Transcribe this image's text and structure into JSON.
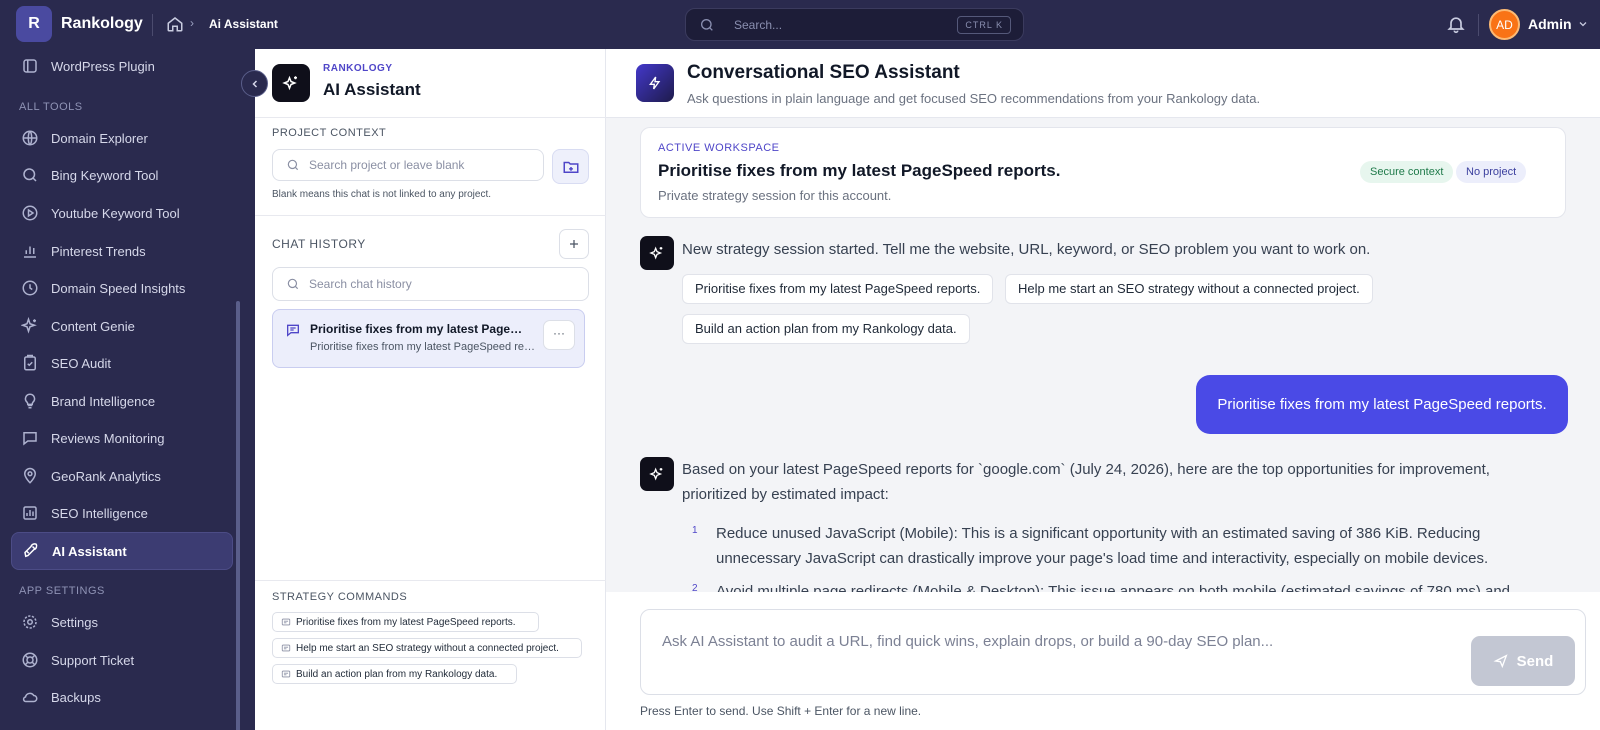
{
  "app": {
    "logo_letter": "R",
    "name": "Rankology"
  },
  "breadcrumb": {
    "current": "Ai Assistant"
  },
  "search": {
    "placeholder": "Search...",
    "shortcut": "CTRL K"
  },
  "user": {
    "initials": "AD",
    "name": "Admin"
  },
  "sidebar": {
    "top_items": [
      {
        "label": "WordPress Plugin",
        "icon": "plug-icon"
      }
    ],
    "sections": [
      {
        "title": "ALL TOOLS",
        "items": [
          {
            "label": "Domain Explorer",
            "icon": "globe-icon"
          },
          {
            "label": "Bing Keyword Tool",
            "icon": "search-icon"
          },
          {
            "label": "Youtube Keyword Tool",
            "icon": "play-circle-icon"
          },
          {
            "label": "Pinterest Trends",
            "icon": "bar-chart-icon"
          },
          {
            "label": "Domain Speed Insights",
            "icon": "clock-icon"
          },
          {
            "label": "Content Genie",
            "icon": "sparkles-icon"
          },
          {
            "label": "SEO Audit",
            "icon": "clipboard-check-icon"
          },
          {
            "label": "Brand Intelligence",
            "icon": "lightbulb-icon"
          },
          {
            "label": "Reviews Monitoring",
            "icon": "message-square-icon"
          },
          {
            "label": "GeoRank Analytics",
            "icon": "map-pin-icon"
          },
          {
            "label": "SEO Intelligence",
            "icon": "line-chart-icon"
          },
          {
            "label": "AI Assistant",
            "icon": "rocket-icon",
            "active": true
          }
        ]
      },
      {
        "title": "APP SETTINGS",
        "items": [
          {
            "label": "Settings",
            "icon": "gear-icon"
          },
          {
            "label": "Support Ticket",
            "icon": "lifebuoy-icon"
          },
          {
            "label": "Backups",
            "icon": "cloud-icon"
          }
        ]
      }
    ]
  },
  "panel": {
    "kicker": "RANKOLOGY",
    "title": "AI Assistant",
    "project_context": {
      "label": "PROJECT CONTEXT",
      "placeholder": "Search project or leave blank",
      "hint": "Blank means this chat is not linked to any project."
    },
    "chat_history": {
      "label": "CHAT HISTORY",
      "search_placeholder": "Search chat history",
      "items": [
        {
          "title": "Prioritise fixes from my latest PageSpeed reports.",
          "preview": "Prioritise fixes from my latest PageSpeed reports.",
          "more": "···"
        }
      ]
    },
    "strategy_commands": {
      "label": "STRATEGY COMMANDS",
      "items": [
        "Prioritise fixes from my latest PageSpeed reports.",
        "Help me start an SEO strategy without a connected project.",
        "Build an action plan from my Rankology data."
      ]
    }
  },
  "main": {
    "title": "Conversational SEO Assistant",
    "subtitle": "Ask questions in plain language and get focused SEO recommendations from your Rankology data.",
    "workspace": {
      "kicker": "ACTIVE WORKSPACE",
      "title": "Prioritise fixes from my latest PageSpeed reports.",
      "subtitle": "Private strategy session for this account.",
      "badges": [
        "Secure context",
        "No project"
      ]
    },
    "messages": {
      "intro": "New strategy session started. Tell me the website, URL, keyword, or SEO problem you want to work on.",
      "suggestions": [
        "Prioritise fixes from my latest PageSpeed reports.",
        "Help me start an SEO strategy without a connected project.",
        "Build an action plan from my Rankology data."
      ],
      "user": "Prioritise fixes from my latest PageSpeed reports.",
      "reply_intro": "Based on your latest PageSpeed reports for `google.com` (July 24, 2026), here are the top opportunities for improvement, prioritized by estimated impact:",
      "reply_items": [
        {
          "num": "1",
          "text": "Reduce unused JavaScript (Mobile): This is a significant opportunity with an estimated saving of 386 KiB. Reducing unnecessary JavaScript can drastically improve your page's load time and interactivity, especially on mobile devices."
        },
        {
          "num": "2",
          "text": "Avoid multiple page redirects (Mobile & Desktop): This issue appears on both mobile (estimated savings of 780 ms) and"
        }
      ]
    },
    "composer": {
      "placeholder": "Ask AI Assistant to audit a URL, find quick wins, explain drops, or build a 90-day SEO plan...",
      "send_label": "Send",
      "hint": "Press Enter to send. Use Shift + Enter for a new line."
    }
  }
}
